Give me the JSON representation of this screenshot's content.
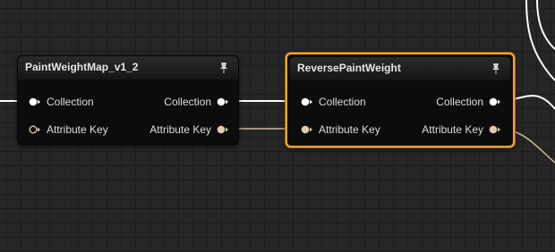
{
  "nodes": [
    {
      "title": "PaintWeightMap_v1_2",
      "selected": false,
      "inputs": [
        {
          "label": "Collection",
          "type": "collection",
          "connected": true
        },
        {
          "label": "Attribute Key",
          "type": "attribute",
          "connected": false
        }
      ],
      "outputs": [
        {
          "label": "Collection",
          "type": "collection",
          "connected": true
        },
        {
          "label": "Attribute Key",
          "type": "attribute",
          "connected": true
        }
      ]
    },
    {
      "title": "ReversePaintWeight",
      "selected": true,
      "inputs": [
        {
          "label": "Collection",
          "type": "collection",
          "connected": true
        },
        {
          "label": "Attribute Key",
          "type": "attribute",
          "connected": true
        }
      ],
      "outputs": [
        {
          "label": "Collection",
          "type": "collection",
          "connected": true
        },
        {
          "label": "Attribute Key",
          "type": "attribute",
          "connected": true
        }
      ]
    }
  ],
  "icons": {
    "pin": "pushpin-icon"
  },
  "colors": {
    "background": "#262626",
    "grid": "#1d1d1d",
    "node_body": "#0c0c0c",
    "selection": "#f5a623",
    "collection_pin": "#ffffff",
    "attribute_pin": "#e2c9a8",
    "collection_wire": "#ffffff",
    "attribute_wire": "#cdb89a"
  }
}
